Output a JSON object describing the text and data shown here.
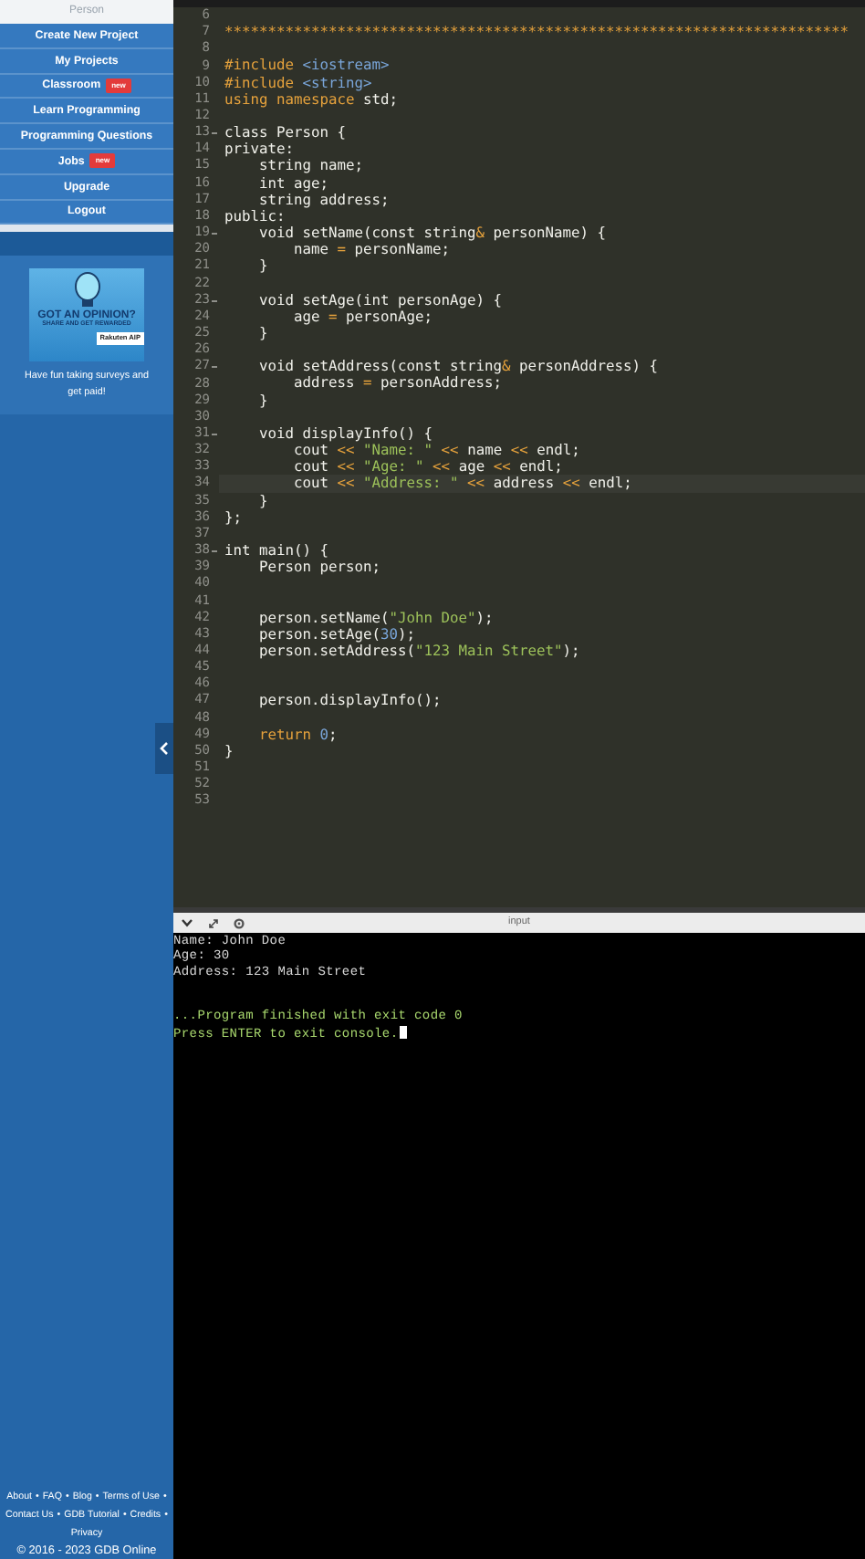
{
  "sidebar": {
    "user_name": "Person",
    "menu": [
      {
        "label": "Create New Project"
      },
      {
        "label": "My Projects"
      },
      {
        "label": "Classroom",
        "badge": "new"
      },
      {
        "label": "Learn Programming"
      },
      {
        "label": "Programming Questions"
      },
      {
        "label": "Jobs",
        "badge": "new"
      },
      {
        "label": "Upgrade"
      },
      {
        "label": "Logout"
      }
    ],
    "ad": {
      "headline": "GOT AN OPINION?",
      "tagline": "SHARE AND GET REWARDED",
      "brand": "Rakuten AIP",
      "caption": "Have fun taking surveys and get paid!"
    },
    "footer": [
      {
        "kind": "link",
        "text": "About"
      },
      {
        "kind": "sep",
        "text": "•"
      },
      {
        "kind": "link",
        "text": "FAQ"
      },
      {
        "kind": "sep",
        "text": "•"
      },
      {
        "kind": "link",
        "text": "Blog"
      },
      {
        "kind": "sep",
        "text": "•"
      },
      {
        "kind": "link",
        "text": "Terms of Use"
      },
      {
        "kind": "sep",
        "text": "•"
      },
      {
        "kind": "link",
        "text": "Contact Us"
      },
      {
        "kind": "sep",
        "text": "•"
      },
      {
        "kind": "link",
        "text": "GDB Tutorial"
      },
      {
        "kind": "sep",
        "text": "•"
      },
      {
        "kind": "link",
        "text": "Credits"
      },
      {
        "kind": "sep",
        "text": "•"
      },
      {
        "kind": "link",
        "text": "Privacy"
      },
      {
        "kind": "text",
        "text": "© 2016 - 2023 GDB Online"
      }
    ]
  },
  "editor": {
    "lines": [
      {
        "number": "6"
      },
      {
        "number": "7",
        "tokens": [
          {
            "kind": "comment",
            "text": "************************************************************************"
          }
        ]
      },
      {
        "number": "8"
      },
      {
        "number": "9",
        "tokens": [
          {
            "kind": "keyword",
            "text": "#include"
          },
          {
            "kind": "header",
            "text": " <iostream>"
          }
        ]
      },
      {
        "number": "10",
        "tokens": [
          {
            "kind": "keyword",
            "text": "#include"
          },
          {
            "kind": "header",
            "text": " <string>"
          }
        ]
      },
      {
        "number": "11",
        "tokens": [
          {
            "kind": "keyword",
            "text": "using namespace"
          },
          {
            "kind": "plain",
            "text": " std;"
          }
        ]
      },
      {
        "number": "12"
      },
      {
        "number": "13",
        "fold": true,
        "tokens": [
          {
            "kind": "plain",
            "text": "class Person {"
          }
        ]
      },
      {
        "number": "14",
        "tokens": [
          {
            "kind": "plain",
            "text": "private:"
          }
        ]
      },
      {
        "number": "15",
        "tokens": [
          {
            "kind": "plain",
            "text": "    string name;"
          }
        ]
      },
      {
        "number": "16",
        "tokens": [
          {
            "kind": "plain",
            "text": "    int age;"
          }
        ]
      },
      {
        "number": "17",
        "tokens": [
          {
            "kind": "plain",
            "text": "    string address;"
          }
        ]
      },
      {
        "number": "18",
        "tokens": [
          {
            "kind": "plain",
            "text": "public:"
          }
        ]
      },
      {
        "number": "19",
        "fold": true,
        "tokens": [
          {
            "kind": "plain",
            "text": "    void setName(const string"
          },
          {
            "kind": "op",
            "text": "&"
          },
          {
            "kind": "plain",
            "text": " personName) {"
          }
        ]
      },
      {
        "number": "20",
        "tokens": [
          {
            "kind": "plain",
            "text": "        name "
          },
          {
            "kind": "op",
            "text": "="
          },
          {
            "kind": "plain",
            "text": " personName;"
          }
        ]
      },
      {
        "number": "21",
        "tokens": [
          {
            "kind": "plain",
            "text": "    }"
          }
        ]
      },
      {
        "number": "22"
      },
      {
        "number": "23",
        "fold": true,
        "tokens": [
          {
            "kind": "plain",
            "text": "    void setAge(int personAge) {"
          }
        ]
      },
      {
        "number": "24",
        "tokens": [
          {
            "kind": "plain",
            "text": "        age "
          },
          {
            "kind": "op",
            "text": "="
          },
          {
            "kind": "plain",
            "text": " personAge;"
          }
        ]
      },
      {
        "number": "25",
        "tokens": [
          {
            "kind": "plain",
            "text": "    }"
          }
        ]
      },
      {
        "number": "26"
      },
      {
        "number": "27",
        "fold": true,
        "tokens": [
          {
            "kind": "plain",
            "text": "    void setAddress(const string"
          },
          {
            "kind": "op",
            "text": "&"
          },
          {
            "kind": "plain",
            "text": " personAddress) {"
          }
        ]
      },
      {
        "number": "28",
        "tokens": [
          {
            "kind": "plain",
            "text": "        address "
          },
          {
            "kind": "op",
            "text": "="
          },
          {
            "kind": "plain",
            "text": " personAddress;"
          }
        ]
      },
      {
        "number": "29",
        "tokens": [
          {
            "kind": "plain",
            "text": "    }"
          }
        ]
      },
      {
        "number": "30"
      },
      {
        "number": "31",
        "fold": true,
        "tokens": [
          {
            "kind": "plain",
            "text": "    void displayInfo() {"
          }
        ]
      },
      {
        "number": "32",
        "tokens": [
          {
            "kind": "plain",
            "text": "        cout "
          },
          {
            "kind": "op",
            "text": "<<"
          },
          {
            "kind": "string",
            "text": " \"Name: \""
          },
          {
            "kind": "op",
            "text": " <<"
          },
          {
            "kind": "plain",
            "text": " name "
          },
          {
            "kind": "op",
            "text": "<<"
          },
          {
            "kind": "plain",
            "text": " endl;"
          }
        ]
      },
      {
        "number": "33",
        "tokens": [
          {
            "kind": "plain",
            "text": "        cout "
          },
          {
            "kind": "op",
            "text": "<<"
          },
          {
            "kind": "string",
            "text": " \"Age: \""
          },
          {
            "kind": "op",
            "text": " <<"
          },
          {
            "kind": "plain",
            "text": " age "
          },
          {
            "kind": "op",
            "text": "<<"
          },
          {
            "kind": "plain",
            "text": " endl;"
          }
        ]
      },
      {
        "number": "34",
        "active": true,
        "tokens": [
          {
            "kind": "plain",
            "text": "        cout "
          },
          {
            "kind": "op",
            "text": "<<"
          },
          {
            "kind": "string",
            "text": " \"Address: \""
          },
          {
            "kind": "op",
            "text": " <<"
          },
          {
            "kind": "plain",
            "text": " address "
          },
          {
            "kind": "op",
            "text": "<<"
          },
          {
            "kind": "plain",
            "text": " endl;"
          }
        ]
      },
      {
        "number": "35",
        "tokens": [
          {
            "kind": "plain",
            "text": "    }"
          }
        ]
      },
      {
        "number": "36",
        "tokens": [
          {
            "kind": "plain",
            "text": "};"
          }
        ]
      },
      {
        "number": "37"
      },
      {
        "number": "38",
        "fold": true,
        "tokens": [
          {
            "kind": "plain",
            "text": "int main() {"
          }
        ]
      },
      {
        "number": "39",
        "tokens": [
          {
            "kind": "plain",
            "text": "    Person person;"
          }
        ]
      },
      {
        "number": "40"
      },
      {
        "number": "41"
      },
      {
        "number": "42",
        "tokens": [
          {
            "kind": "plain",
            "text": "    person.setName("
          },
          {
            "kind": "string",
            "text": "\"John Doe\""
          },
          {
            "kind": "plain",
            "text": ");"
          }
        ]
      },
      {
        "number": "43",
        "tokens": [
          {
            "kind": "plain",
            "text": "    person.setAge("
          },
          {
            "kind": "number",
            "text": "30"
          },
          {
            "kind": "plain",
            "text": ");"
          }
        ]
      },
      {
        "number": "44",
        "tokens": [
          {
            "kind": "plain",
            "text": "    person.setAddress("
          },
          {
            "kind": "string",
            "text": "\"123 Main Street\""
          },
          {
            "kind": "plain",
            "text": ");"
          }
        ]
      },
      {
        "number": "45"
      },
      {
        "number": "46"
      },
      {
        "number": "47",
        "tokens": [
          {
            "kind": "plain",
            "text": "    person.displayInfo();"
          }
        ]
      },
      {
        "number": "48"
      },
      {
        "number": "49",
        "tokens": [
          {
            "kind": "keyword",
            "text": "    return"
          },
          {
            "kind": "number",
            "text": " 0"
          },
          {
            "kind": "plain",
            "text": ";"
          }
        ]
      },
      {
        "number": "50",
        "tokens": [
          {
            "kind": "plain",
            "text": "}"
          }
        ]
      },
      {
        "number": "51"
      },
      {
        "number": "52"
      },
      {
        "number": "53"
      }
    ]
  },
  "console": {
    "input_label": "input",
    "cursor": true,
    "lines": [
      {
        "kind": "output",
        "text": "Name: John Doe"
      },
      {
        "kind": "output",
        "text": "Age: 30"
      },
      {
        "kind": "output",
        "text": "Address: 123 Main Street"
      },
      {
        "kind": "blank"
      },
      {
        "kind": "blank"
      },
      {
        "kind": "status",
        "text": "...Program finished with exit code 0"
      },
      {
        "kind": "status",
        "text": "Press ENTER to exit console."
      }
    ]
  }
}
